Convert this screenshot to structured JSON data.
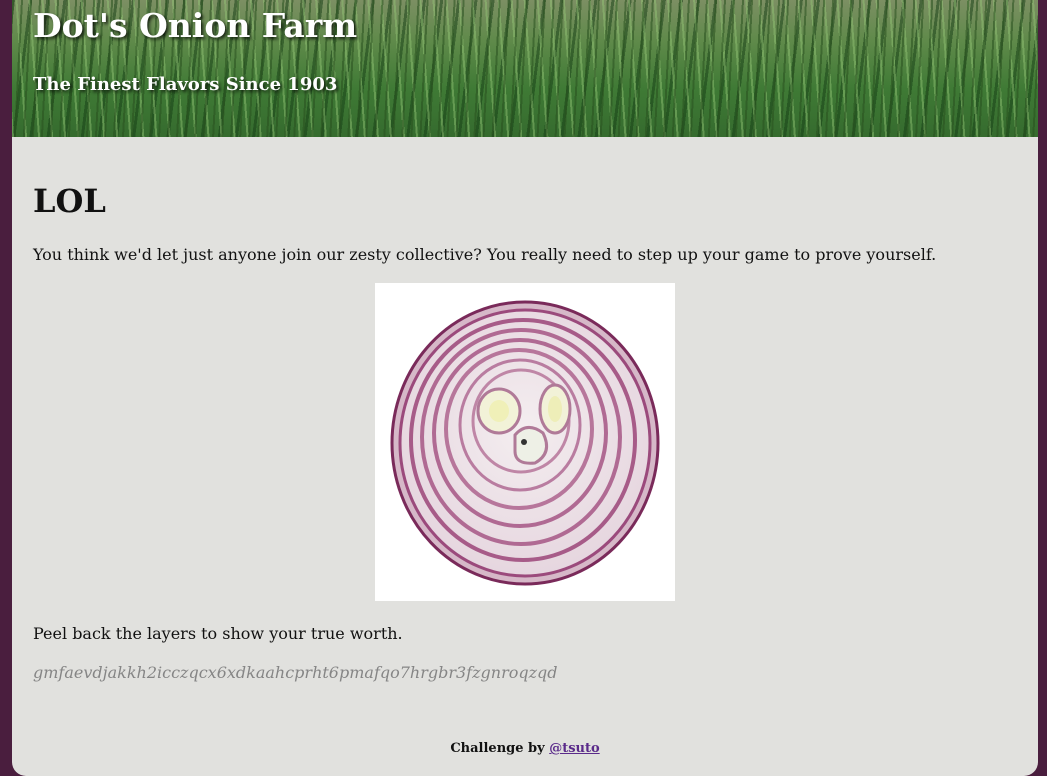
{
  "header": {
    "title": "Dot's Onion Farm",
    "subtitle": "The Finest Flavors Since 1903"
  },
  "main": {
    "heading": "LOL",
    "intro": "You think we'd let just anyone join our zesty collective? You really need to step up your game to prove yourself.",
    "image_name": "onion-cross-section",
    "peel_text": "Peel back the layers to show your true worth.",
    "secret_string": "gmfaevdjakkh2icczqcx6xdkaahcprht6pmafqo7hrgbr3fzgnroqzqd"
  },
  "footer": {
    "credit_prefix": "Challenge by ",
    "credit_link": "@tsuto"
  },
  "colors": {
    "frame": "#4a1e3e",
    "page_bg": "#e1e1de",
    "secret_text": "#858585",
    "link": "#5a2a8a"
  }
}
